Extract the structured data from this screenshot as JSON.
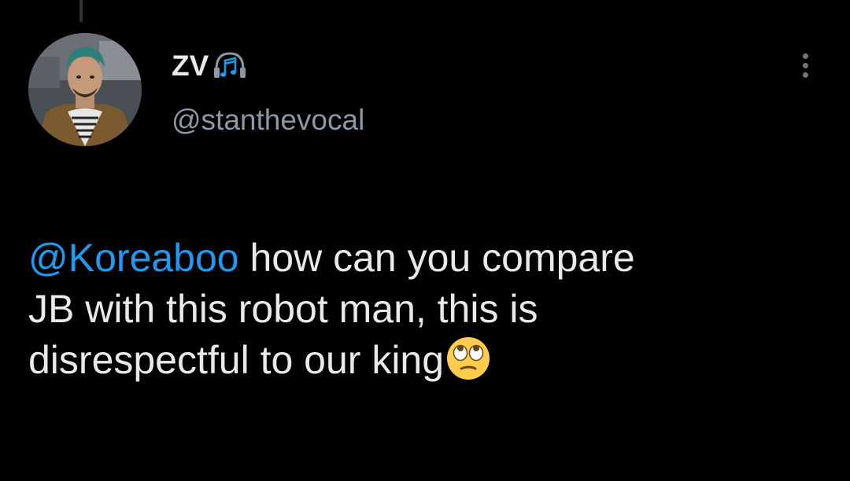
{
  "tweet": {
    "author": {
      "display_name": "ZV",
      "badge_icon": "headphones-music-icon",
      "handle": "@stanthevocal"
    },
    "body": {
      "mention": "@Koreaboo",
      "text_line1": " how can you compare",
      "text_line2": "JB with this robot man, this is",
      "text_line3": "disrespectful to our king",
      "emoji": "face-with-rolling-eyes-emoji"
    },
    "menu_icon": "more-vertical-icon"
  },
  "colors": {
    "background": "#000000",
    "text": "#e7e9ea",
    "secondary_text": "#8b98a5",
    "mention": "#1d9bf0",
    "accent": "#1d9bf0"
  }
}
